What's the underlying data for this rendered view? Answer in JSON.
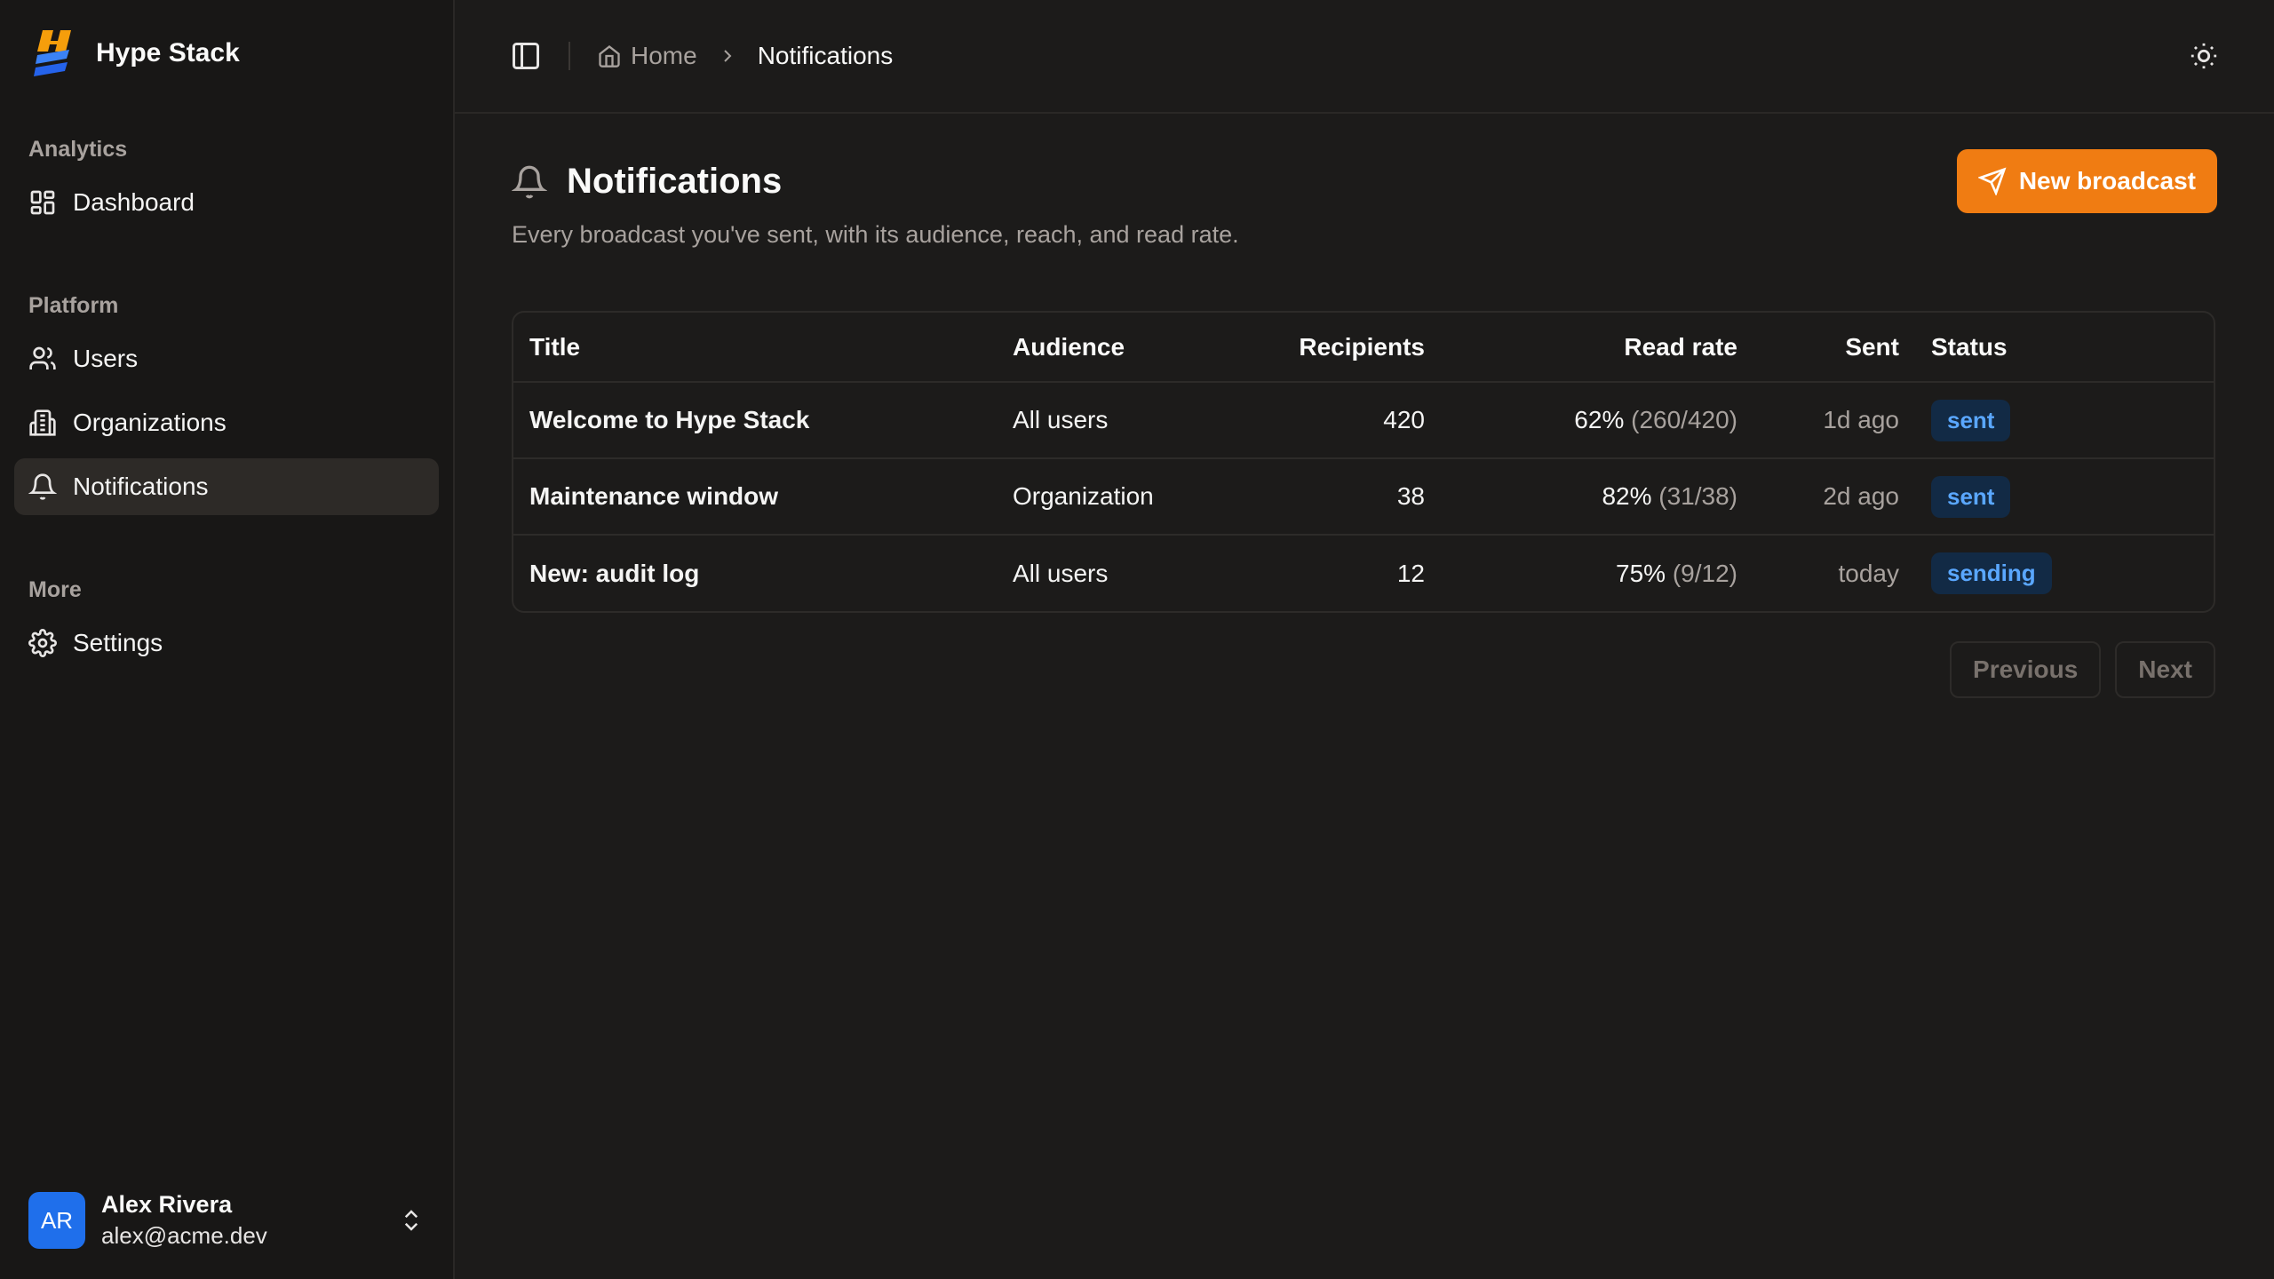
{
  "brand": {
    "name": "Hype Stack"
  },
  "sidebar": {
    "groups": [
      {
        "label": "Analytics",
        "items": [
          {
            "label": "Dashboard",
            "icon": "dashboard-icon"
          }
        ]
      },
      {
        "label": "Platform",
        "items": [
          {
            "label": "Users",
            "icon": "users-icon"
          },
          {
            "label": "Organizations",
            "icon": "building-icon"
          },
          {
            "label": "Notifications",
            "icon": "bell-icon",
            "active": true
          }
        ]
      },
      {
        "label": "More",
        "items": [
          {
            "label": "Settings",
            "icon": "gear-icon"
          }
        ]
      }
    ],
    "user": {
      "initials": "AR",
      "name": "Alex Rivera",
      "email": "alex@acme.dev"
    }
  },
  "header": {
    "breadcrumb_home": "Home",
    "breadcrumb_current": "Notifications"
  },
  "page": {
    "title": "Notifications",
    "subtitle": "Every broadcast you've sent, with its audience, reach, and read rate.",
    "new_button": "New broadcast"
  },
  "table": {
    "columns": [
      "Title",
      "Audience",
      "Recipients",
      "Read rate",
      "Sent",
      "Status"
    ],
    "rows": [
      {
        "title": "Welcome to Hype Stack",
        "audience": "All users",
        "recipients": "420",
        "read_pct": "62%",
        "read_ratio": "(260/420)",
        "sent": "1d ago",
        "status": "sent"
      },
      {
        "title": "Maintenance window",
        "audience": "Organization",
        "recipients": "38",
        "read_pct": "82%",
        "read_ratio": "(31/38)",
        "sent": "2d ago",
        "status": "sent"
      },
      {
        "title": "New: audit log",
        "audience": "All users",
        "recipients": "12",
        "read_pct": "75%",
        "read_ratio": "(9/12)",
        "sent": "today",
        "status": "sending"
      }
    ]
  },
  "pager": {
    "previous": "Previous",
    "next": "Next"
  },
  "colors": {
    "accent": "#f07c12",
    "badge_bg": "#122a45",
    "badge_text": "#5aa7ff",
    "avatar": "#1f6feb"
  }
}
